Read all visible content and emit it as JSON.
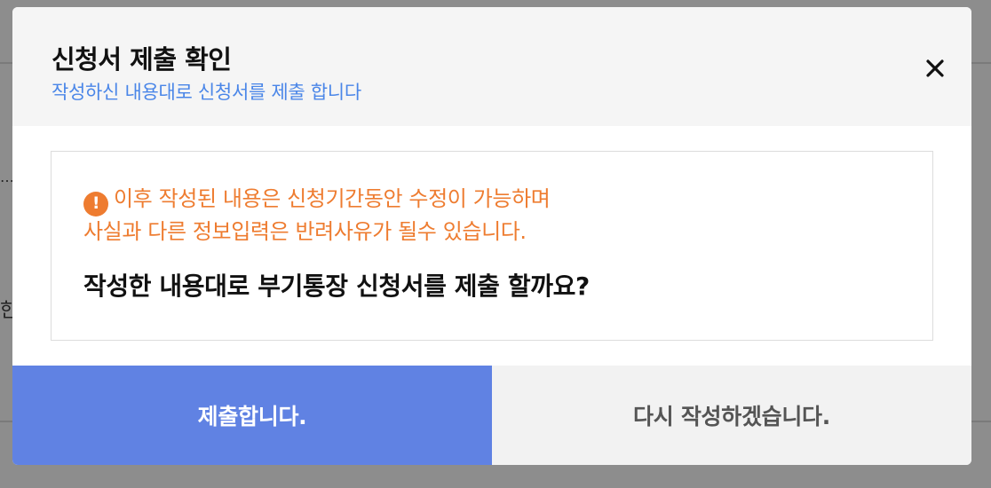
{
  "background": {
    "partial_text_1": "…",
    "partial_text_2": "한"
  },
  "modal": {
    "title": "신청서 제출 확인",
    "subtitle": "작성하신 내용대로 신청서를 제출 합니다",
    "close_icon": "close-icon",
    "notice": {
      "icon": "exclamation-circle-icon",
      "icon_glyph": "!",
      "line1": "이후 작성된 내용은 신청기간동안 수정이 가능하며",
      "line2": "사실과 다른 정보입력은 반려사유가 될수 있습니다."
    },
    "question": "작성한 내용대로 부기통장 신청서를 제출 할까요?",
    "buttons": {
      "submit_label": "제출합니다.",
      "rewrite_label": "다시 작성하겠습니다."
    }
  },
  "colors": {
    "overlay": "#8d8d8d",
    "header_bg": "#f5f5f5",
    "accent_blue": "#4a86e8",
    "submit_bg": "#6082e3",
    "rewrite_bg": "#f2f2f2",
    "warning_orange": "#ee7c30"
  }
}
